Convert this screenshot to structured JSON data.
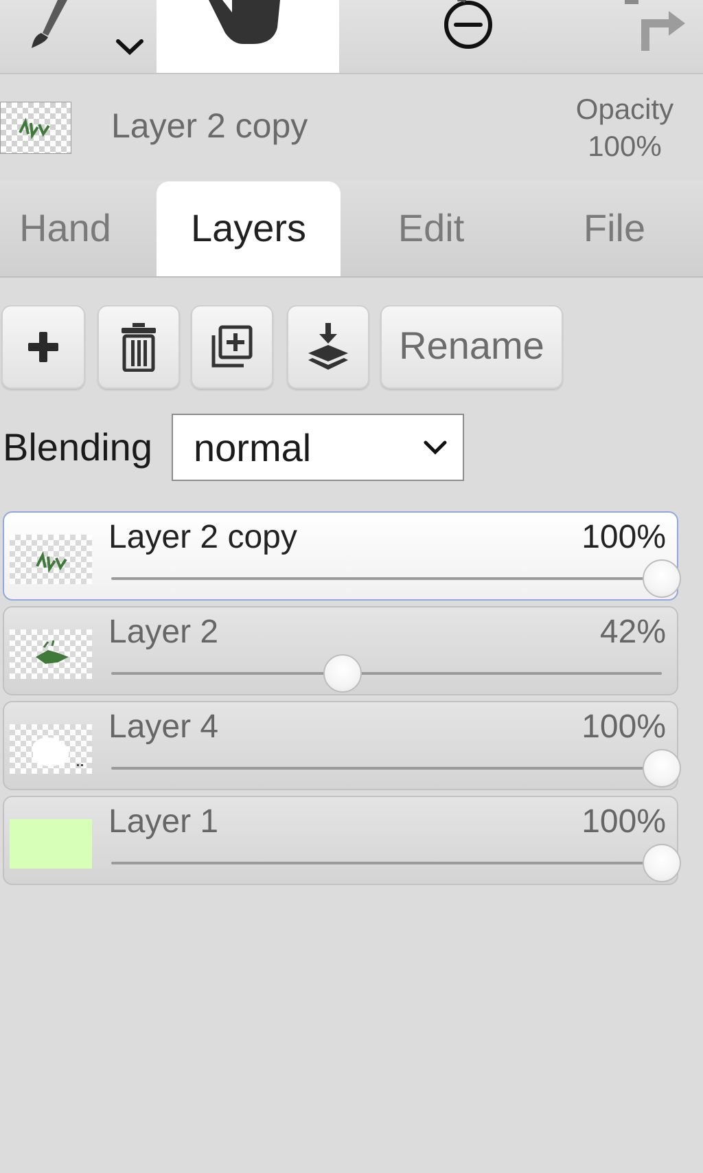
{
  "toolbar": {
    "tools": [
      {
        "name": "brush",
        "icon": "brush-icon"
      },
      {
        "name": "hand",
        "icon": "hand-icon",
        "active": true
      },
      {
        "name": "zoom-out",
        "icon": "zoom-out-icon"
      },
      {
        "name": "redo",
        "icon": "redo-icon"
      }
    ]
  },
  "current_layer": {
    "name": "Layer 2 copy",
    "opacity_label": "Opacity",
    "opacity_value": "100%"
  },
  "tabs": [
    {
      "label": "Hand",
      "active": false
    },
    {
      "label": "Layers",
      "active": true
    },
    {
      "label": "Edit",
      "active": false
    },
    {
      "label": "File",
      "active": false
    }
  ],
  "actions": {
    "add_icon": "plus-icon",
    "delete_icon": "trash-icon",
    "duplicate_icon": "duplicate-icon",
    "merge_icon": "merge-down-icon",
    "rename_label": "Rename"
  },
  "blending": {
    "label": "Blending",
    "value": "normal"
  },
  "layers": [
    {
      "name": "Layer 2 copy",
      "opacity": "100%",
      "opacity_fraction": 1.0,
      "selected": true,
      "thumb": "checker-green-sketch"
    },
    {
      "name": "Layer 2",
      "opacity": "42%",
      "opacity_fraction": 0.42,
      "selected": false,
      "thumb": "checker-green-sketch"
    },
    {
      "name": "Layer 4",
      "opacity": "100%",
      "opacity_fraction": 1.0,
      "selected": false,
      "thumb": "checker-white-shape"
    },
    {
      "name": "Layer 1",
      "opacity": "100%",
      "opacity_fraction": 1.0,
      "selected": false,
      "thumb": "solid-light-green"
    }
  ],
  "colors": {
    "selected_border": "#8fa8e2",
    "layer1_fill": "#d8ffb8",
    "sketch_green": "#3f7a3a"
  }
}
